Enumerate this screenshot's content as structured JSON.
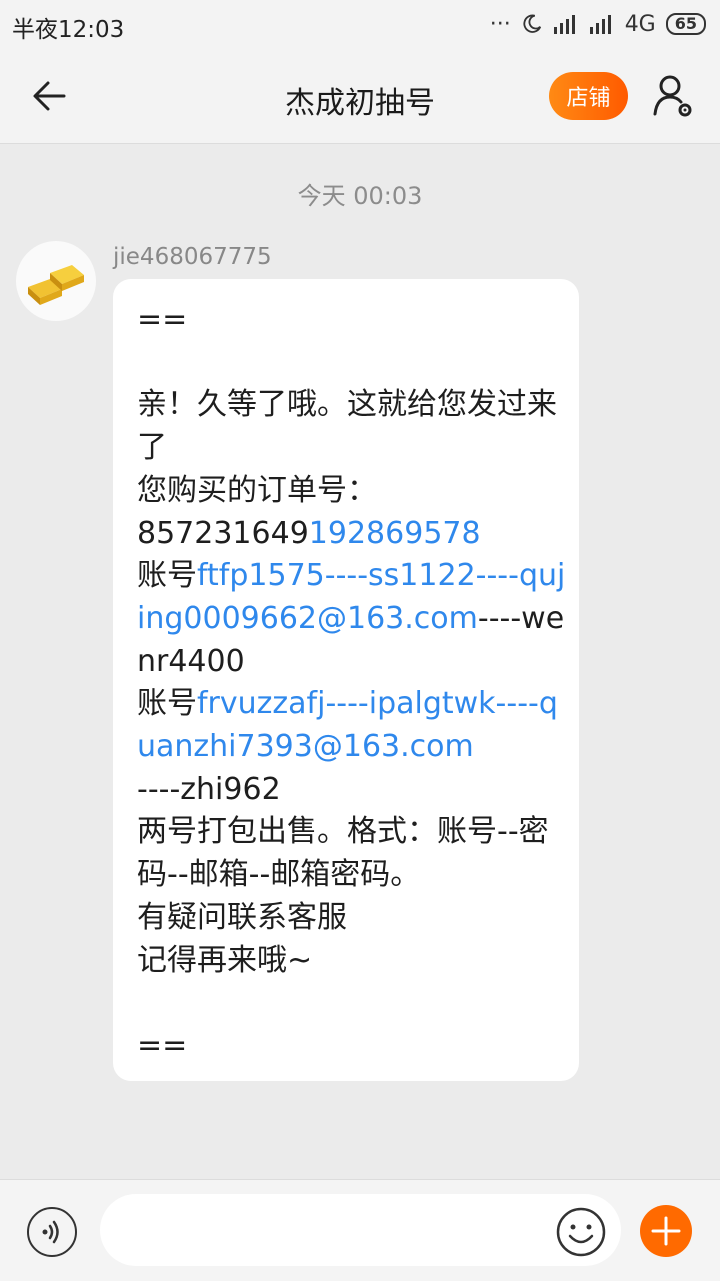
{
  "status_bar": {
    "time": "半夜12:03",
    "dots": "···",
    "network": "4G",
    "battery": "65"
  },
  "header": {
    "title": "杰成初抽号",
    "shop_button": "店铺"
  },
  "chat": {
    "date_label": "今天  00:03",
    "message": {
      "sender": "jie468067775",
      "lines": {
        "l1": "==",
        "l3": "亲！久等了哦。这就给您发过来了",
        "l4": "您购买的订单号：",
        "order_prefix": "857231649",
        "order_link": "192869578",
        "acc1_label": "账号",
        "acc1_link": "ftfp1575----ss1122----qujing0009662@163.com",
        "acc1_rest": "----wenr4400",
        "acc2_label": "账号",
        "acc2_link": "frvuzzafj----ipalgtwk----quanzhi7393@163.com",
        "acc2_rest": "----zhi962",
        "l9": "两号打包出售。格式：账号--密码--邮箱--邮箱密码。",
        "l10": "有疑问联系客服",
        "l11": "记得再来哦~",
        "l13": "=="
      }
    }
  },
  "icons": {
    "back": "arrow-left-icon",
    "profile": "user-settings-icon",
    "voice": "voice-icon",
    "emoji": "emoji-icon",
    "plus": "plus-icon"
  },
  "colors": {
    "accent": "#ff6a00",
    "link": "#2f88ec"
  }
}
